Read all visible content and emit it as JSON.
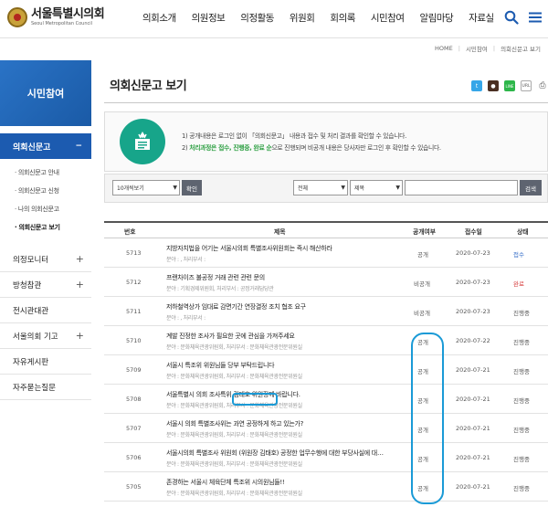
{
  "header": {
    "logo_kr": "서울특별시의회",
    "logo_en": "Seoul Metropolitan Council",
    "nav": [
      "의회소개",
      "의원정보",
      "의정활동",
      "위원회",
      "회의록",
      "시민참여",
      "알림마당",
      "자료실"
    ]
  },
  "breadcrumb": [
    "HOME",
    "시민참여",
    "의회신문고 보기"
  ],
  "sidebar": {
    "title": "시민참여",
    "active": "의회신문고",
    "active_toggle": "−",
    "sub_items": [
      "· 의회신문고 안내",
      "· 의회신문고 신청",
      "· 나의 의회신문고",
      "· 의회신문고 보기"
    ],
    "menu": [
      {
        "label": "의정모니터",
        "toggle": "+"
      },
      {
        "label": "방청참관",
        "toggle": "+"
      },
      {
        "label": "전시관대관",
        "toggle": ""
      },
      {
        "label": "서울의회 기고",
        "toggle": "+"
      },
      {
        "label": "자유게시판",
        "toggle": ""
      },
      {
        "label": "자주묻는질문",
        "toggle": ""
      }
    ]
  },
  "main": {
    "title": "의회신문고 보기",
    "share": {
      "twitter": "t",
      "talk": "●",
      "line": "LINE",
      "url": "URL",
      "print": "⎙"
    },
    "info": {
      "line1": "1) 공개내용은 로그인 없이 「의회신문고」 내용과 접수 및 처리 결과를 확인할 수 있습니다.",
      "line2_prefix": "2) ",
      "line2_highlight": "처리과정은 접수, 진행중, 완료 순",
      "line2_suffix": "으로 진행되며 비공개 내용은 당사자만 로그인 후 확인할 수 있습니다."
    },
    "filter": {
      "per_page": "10개씩보기",
      "confirm": "확인",
      "scope": "전체",
      "field": "제목",
      "search": "검색"
    },
    "table": {
      "headers": {
        "num": "번호",
        "title": "제목",
        "public": "공개여부",
        "date": "접수일",
        "status": "상태"
      },
      "rows": [
        {
          "num": "5713",
          "title": "지방자치법을 어기는 서울시의회 특별조사위원회는 즉시 해산하라",
          "sub": "분야 : , 처리부서 :",
          "public": "공개",
          "date": "2020-07-23",
          "status": "접수"
        },
        {
          "num": "5712",
          "title": "프랜차이즈 불공정 거래 관련 관련 문의",
          "sub": "분야 : 기획경제위원회, 처리부서 : 공정거래담당관",
          "public": "비공개",
          "date": "2020-07-23",
          "status": "완료"
        },
        {
          "num": "5711",
          "title": "저하철역상가 임대료 감면기간 연장결정 조치 협조 요구",
          "sub": "분야 : , 처리부서 :",
          "public": "비공개",
          "date": "2020-07-23",
          "status": "진행중"
        },
        {
          "num": "5710",
          "title": "계발 진정한 조사가 필요한 곳에 관심을 가져주세요",
          "sub": "분야 : 문화체육관광위원회, 처리부서 : 문화체육관광전문위원실",
          "public": "공개",
          "date": "2020-07-22",
          "status": "진행중"
        },
        {
          "num": "5709",
          "title": "서울시 특조위 위원님들 당부 부탁드립니다",
          "sub": "분야 : 문화체육관광위원회, 처리부서 : 문화체육관광전문위원실",
          "public": "공개",
          "date": "2020-07-21",
          "status": "진행중"
        },
        {
          "num": "5708",
          "title": "서울특별시 의회 조사특위 김태호 위원장께 바랍니다.",
          "sub": "분야 : 문화체육관광위원회, 처리부서 : 문화체육관광전문위원실",
          "public": "공개",
          "date": "2020-07-21",
          "status": "진행중"
        },
        {
          "num": "5707",
          "title": "서울시 의회 특별조사위는 과연 공정하게 하고 있는가?",
          "sub": "분야 : 문화체육관광위원회, 처리부서 : 문화체육관광전문위원실",
          "public": "공개",
          "date": "2020-07-21",
          "status": "진행중"
        },
        {
          "num": "5706",
          "title": "서울시의회 특별조사 위원회 (위원장 김태호) 공정한 업무수행에 대한 부당사실에 대…",
          "sub": "분야 : 문화체육관광위원회, 처리부서 : 문화체육관광전문위원실",
          "public": "공개",
          "date": "2020-07-21",
          "status": "진행중"
        },
        {
          "num": "5705",
          "title": "존경하는 서울시 체육단체 특조위 시의원님들!!",
          "sub": "분야 : 문화체육관광위원회, 처리부서 : 문화체육관광전문위원실",
          "public": "공개",
          "date": "2020-07-21",
          "status": "진행중"
        }
      ]
    }
  },
  "colors": {
    "brand_blue": "#1c5bb0",
    "teal": "#17a58a",
    "annotation": "#1a9ad6",
    "status_red": "#d63c3c",
    "status_blue": "#3a71c9"
  }
}
